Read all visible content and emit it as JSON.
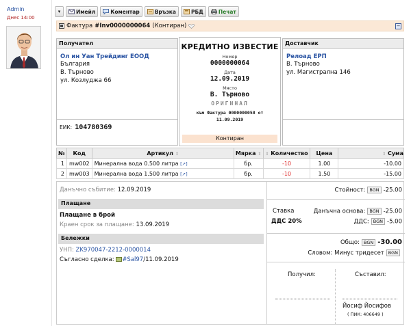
{
  "user": {
    "name": "Admin",
    "time": "Днес 14:00"
  },
  "toolbar": {
    "email": "Имейл",
    "comment": "Коментар",
    "link": "Връзка",
    "rbd": "РБД",
    "print": "Печат"
  },
  "titlebar": {
    "prefix": "Фактура",
    "number": "#Inv0000000064",
    "state": "(Контиран)"
  },
  "recipient": {
    "header": "Получател",
    "name": "Ол ин Уан Трейдинг ЕООД",
    "country": "България",
    "city": "В. Търново",
    "street": "ул. Козлуджа 66",
    "eik_label": "ЕИК:",
    "eik": "104780369"
  },
  "supplier": {
    "header": "Доставчик",
    "name": "Релоад ЕРП",
    "city": "В. Търново",
    "street": "ул. Магистрална 146"
  },
  "doc": {
    "title": "КРЕДИТНО ИЗВЕСТИЕ",
    "number_label": "Номер",
    "number": "0000000064",
    "date_label": "Дата",
    "date": "12.09.2019",
    "place_label": "Място",
    "place": "В. Търново",
    "original": "ОРИГИНАЛ",
    "ref_line1": "към Фактура 0000000058 от",
    "ref_line2": "11.09.2019",
    "status": "Контиран"
  },
  "table": {
    "headers": [
      "№",
      "Код",
      "Артикул",
      "Мярка",
      "Количество",
      "Цена",
      "Сума"
    ],
    "rows": [
      {
        "n": "1",
        "code": "mw002",
        "item": "Минерална вода 0.500 литра",
        "unit": "бр.",
        "qty": "-10",
        "price": "1.00",
        "sum": "-10.00"
      },
      {
        "n": "2",
        "code": "mw003",
        "item": "Минерална вода 1.500 литра",
        "unit": "бр.",
        "qty": "-10",
        "price": "1.50",
        "sum": "-15.00"
      }
    ]
  },
  "lower": {
    "tax_event_label": "Данъчно събитие:",
    "tax_event": "12.09.2019",
    "payment_header": "Плащане",
    "payment_method": "Плащане в брой",
    "due_label": "Краен срок за плащане:",
    "due": "13.09.2019",
    "notes_header": "Бележки",
    "unp_label": "УНП:",
    "unp": "ZK970047-2212-0000014",
    "deal_label": "Съгласно сделка:",
    "deal": "#Sal97",
    "deal_date": "/11.09.2019"
  },
  "totals": {
    "value_label": "Стойност:",
    "currency": "BGN",
    "value": "-25.00",
    "rate_label": "Ставка",
    "vat_rate": "ДДС 20%",
    "base_label": "Данъчна основа:",
    "base": "-25.00",
    "vat_label": "ДДС:",
    "vat": "-5.00",
    "total_label": "Общо:",
    "total": "-30.00",
    "words_label": "Словом:",
    "words": "Минус тридесет"
  },
  "signatures": {
    "received": "Получил:",
    "composed": "Съставил:",
    "composer": "Йосиф Йосифов",
    "pik": "( ПИК: 406649 )"
  }
}
